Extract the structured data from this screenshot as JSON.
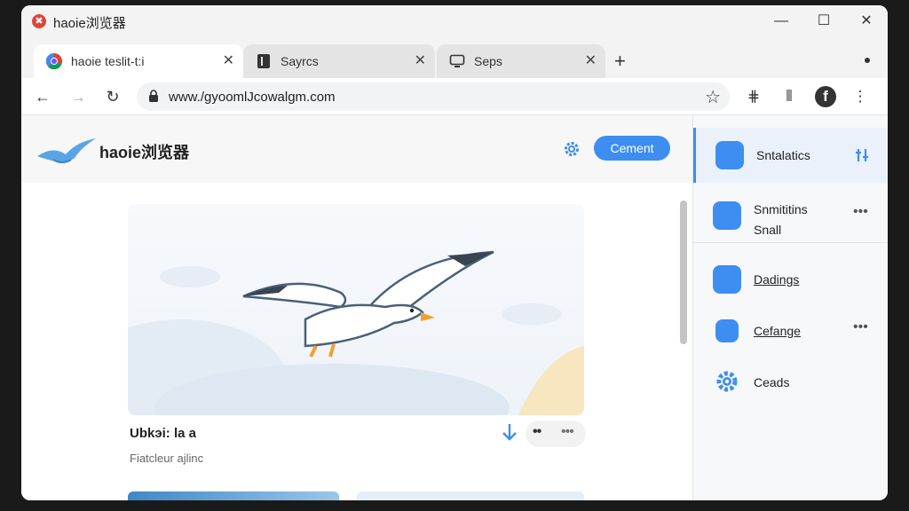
{
  "window": {
    "title": "haoie浏览器",
    "controls": {
      "minimize": "—",
      "maximize": "☐",
      "close": "✕"
    }
  },
  "tabs": [
    {
      "label": "haoie teslit-t:i",
      "close": "✕",
      "active": true
    },
    {
      "label": "Sayrcs",
      "close": "✕",
      "active": false
    },
    {
      "label": "Seps",
      "close": "✕",
      "active": false
    }
  ],
  "newtab": "+",
  "toolbar": {
    "back": "←",
    "forward": "→",
    "reload": "↻",
    "url": "www./gyoomlJcowalgm.com",
    "star": "☆",
    "ext1": "⋕",
    "ext2": "⦀",
    "ext3": "f",
    "menu": "⋮"
  },
  "page": {
    "brand": "haoie浏览器",
    "action_button": "Cement",
    "card": {
      "title": "Ubkэi: la a",
      "subtitle": "Fiatcleur ajlinc",
      "more_dots": "••",
      "more_dots2": "•••"
    }
  },
  "sidebar": {
    "items": [
      {
        "label": "Sntalatics",
        "extra": "",
        "active": true
      },
      {
        "label": "Snmititins\nSnall",
        "extra": "•••",
        "active": false
      },
      {
        "label": "Dadings",
        "extra": "",
        "active": false
      },
      {
        "label": "Cefange",
        "extra": "•••",
        "active": false
      },
      {
        "label": "Ceads",
        "extra": "",
        "active": false
      }
    ]
  },
  "colors": {
    "accent": "#3d8ef0",
    "titlebar": "#f3f3f3",
    "window_bg": "#ffffff"
  }
}
